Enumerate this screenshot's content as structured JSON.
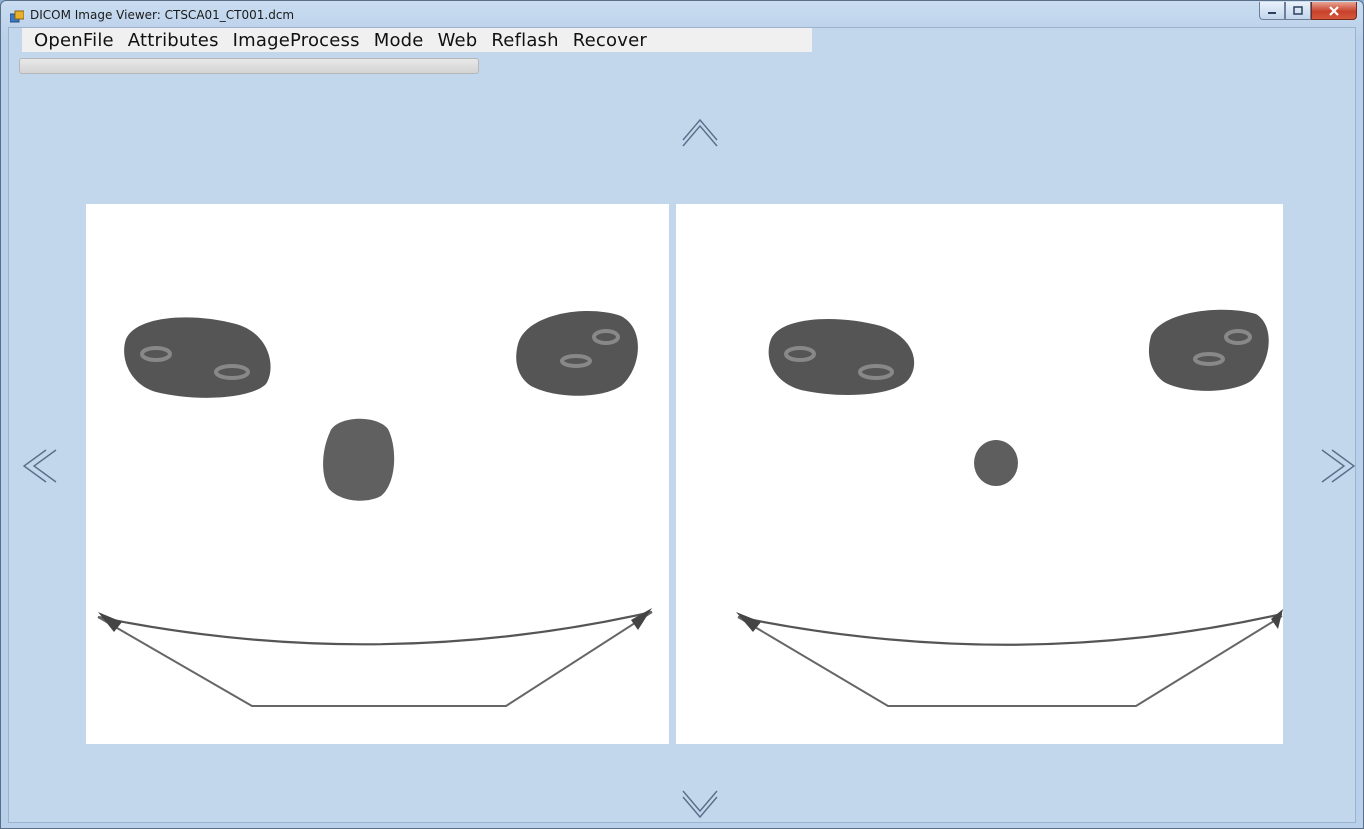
{
  "window": {
    "title": "DICOM Image Viewer: CTSCA01_CT001.dcm",
    "controls": {
      "minimize": "minimize",
      "maximize": "maximize",
      "close": "close"
    }
  },
  "menubar": {
    "items": [
      "OpenFile",
      "Attributes",
      "ImageProcess",
      "Mode",
      "Web",
      "Reflash",
      "Recover"
    ]
  },
  "progress": {
    "value": 0
  },
  "navigation": {
    "up": "chevron-up-icon",
    "down": "chevron-down-icon",
    "left": "chevron-left-icon",
    "right": "chevron-right-icon"
  },
  "colors": {
    "client_bg": "#c2d7ec",
    "image_bg": "#ffffff",
    "tissue": "#555555"
  }
}
